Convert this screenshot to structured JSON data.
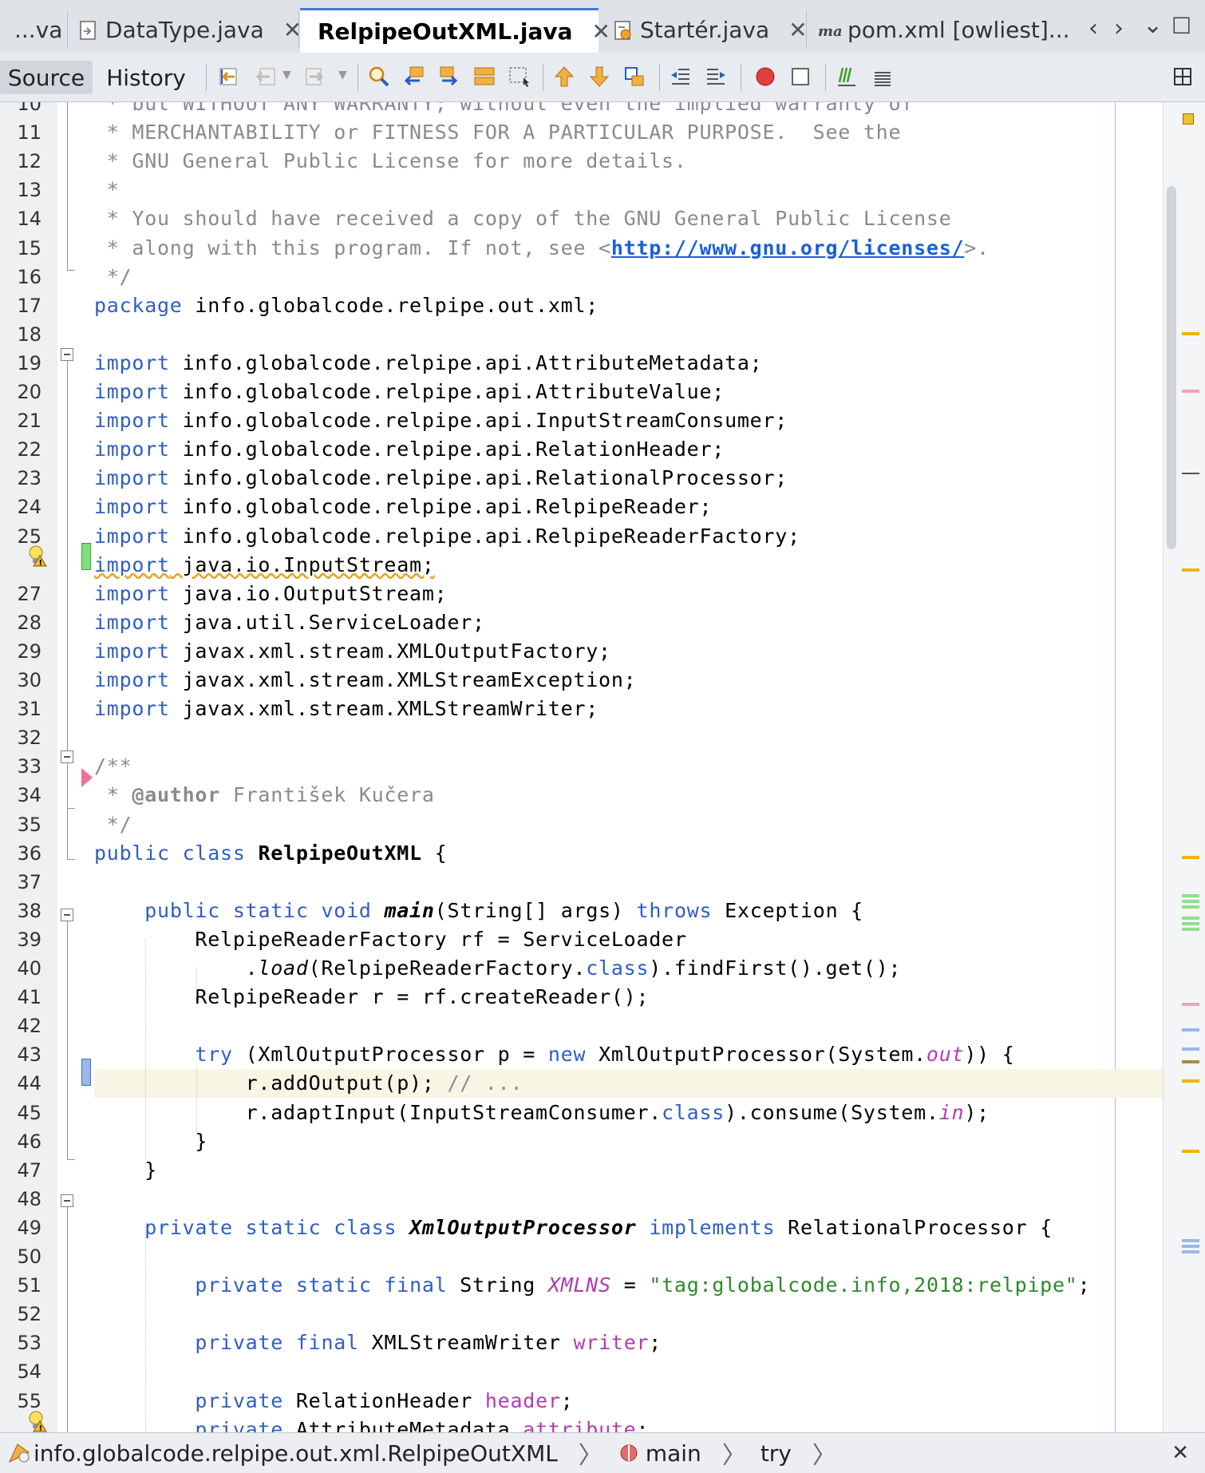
{
  "tabs": [
    {
      "label": "...va",
      "closable": false
    },
    {
      "label": "DataType.java",
      "closable": true
    },
    {
      "label": "RelpipeOutXML.java",
      "closable": true,
      "active": true
    },
    {
      "label": "Startér.java",
      "closable": true
    },
    {
      "label": "pom.xml [owliest]...",
      "closable": false
    }
  ],
  "tab_nav": {
    "prev": "‹",
    "next": "›",
    "menu": "⌄",
    "maximize": "☐"
  },
  "toolbar": {
    "source_label": "Source",
    "history_label": "History"
  },
  "breadcrumb": {
    "items": [
      "info.globalcode.relpipe.out.xml.RelpipeOutXML",
      "main",
      "try"
    ],
    "close": "✕"
  },
  "colors": {
    "keyword": "#2f5ec4",
    "comment": "#8a8a8a",
    "string": "#2c8a2c",
    "field": "#b03cb0",
    "active_tab_accent": "#3d7bd8"
  },
  "lines": [
    {
      "n": "10",
      "tokens": [
        [
          "cm",
          " * but WITHOUT ANY WARRANTY; without even the implied warranty of"
        ]
      ]
    },
    {
      "n": "11",
      "tokens": [
        [
          "cm",
          " * MERCHANTABILITY or FITNESS FOR A PARTICULAR PURPOSE.  See the"
        ]
      ]
    },
    {
      "n": "12",
      "tokens": [
        [
          "cm",
          " * GNU General Public License for more details."
        ]
      ]
    },
    {
      "n": "13",
      "tokens": [
        [
          "cm",
          " *"
        ]
      ]
    },
    {
      "n": "14",
      "tokens": [
        [
          "cm",
          " * You should have received a copy of the GNU General Public License"
        ]
      ]
    },
    {
      "n": "15",
      "tokens": [
        [
          "cm",
          " * along with this program. If not, see <"
        ],
        [
          "link",
          "http://www.gnu.org/licenses/"
        ],
        [
          "cm",
          ">."
        ]
      ]
    },
    {
      "n": "16",
      "tokens": [
        [
          "cm",
          " */"
        ]
      ]
    },
    {
      "n": "17",
      "tokens": [
        [
          "kw",
          "package"
        ],
        [
          "",
          " info.globalcode.relpipe.out.xml;"
        ]
      ]
    },
    {
      "n": "18",
      "tokens": []
    },
    {
      "n": "19",
      "tokens": [
        [
          "kw",
          "import"
        ],
        [
          "",
          " info.globalcode.relpipe.api.AttributeMetadata;"
        ]
      ]
    },
    {
      "n": "20",
      "tokens": [
        [
          "kw",
          "import"
        ],
        [
          "",
          " info.globalcode.relpipe.api.AttributeValue;"
        ]
      ]
    },
    {
      "n": "21",
      "tokens": [
        [
          "kw",
          "import"
        ],
        [
          "",
          " info.globalcode.relpipe.api.InputStreamConsumer;"
        ]
      ]
    },
    {
      "n": "22",
      "tokens": [
        [
          "kw",
          "import"
        ],
        [
          "",
          " info.globalcode.relpipe.api.RelationHeader;"
        ]
      ]
    },
    {
      "n": "23",
      "tokens": [
        [
          "kw",
          "import"
        ],
        [
          "",
          " info.globalcode.relpipe.api.RelationalProcessor;"
        ]
      ]
    },
    {
      "n": "24",
      "tokens": [
        [
          "kw",
          "import"
        ],
        [
          "",
          " info.globalcode.relpipe.api.RelpipeReader;"
        ]
      ]
    },
    {
      "n": "25",
      "tokens": [
        [
          "kw",
          "import"
        ],
        [
          "",
          " info.globalcode.relpipe.api.RelpipeReaderFactory;"
        ]
      ]
    },
    {
      "n": "",
      "tokens": [
        [
          "warnkw",
          "import"
        ],
        [
          "warn",
          " java.io.InputStream;"
        ]
      ]
    },
    {
      "n": "27",
      "tokens": [
        [
          "kw",
          "import"
        ],
        [
          "",
          " java.io.OutputStream;"
        ]
      ]
    },
    {
      "n": "28",
      "tokens": [
        [
          "kw",
          "import"
        ],
        [
          "",
          " java.util.ServiceLoader;"
        ]
      ]
    },
    {
      "n": "29",
      "tokens": [
        [
          "kw",
          "import"
        ],
        [
          "",
          " javax.xml.stream.XMLOutputFactory;"
        ]
      ]
    },
    {
      "n": "30",
      "tokens": [
        [
          "kw",
          "import"
        ],
        [
          "",
          " javax.xml.stream.XMLStreamException;"
        ]
      ]
    },
    {
      "n": "31",
      "tokens": [
        [
          "kw",
          "import"
        ],
        [
          "",
          " javax.xml.stream.XMLStreamWriter;"
        ]
      ]
    },
    {
      "n": "32",
      "tokens": []
    },
    {
      "n": "33",
      "tokens": [
        [
          "cm",
          "/**"
        ]
      ]
    },
    {
      "n": "34",
      "tokens": [
        [
          "cm",
          " * "
        ],
        [
          "tag",
          "@author"
        ],
        [
          "cm",
          " František Kučera"
        ]
      ]
    },
    {
      "n": "35",
      "tokens": [
        [
          "cm",
          " */"
        ]
      ]
    },
    {
      "n": "36",
      "tokens": [
        [
          "kw",
          "public"
        ],
        [
          "",
          " "
        ],
        [
          "kw",
          "class"
        ],
        [
          "",
          " "
        ],
        [
          "bold",
          "RelpipeOutXML"
        ],
        [
          "",
          " {"
        ]
      ]
    },
    {
      "n": "37",
      "tokens": []
    },
    {
      "n": "38",
      "tokens": [
        [
          "",
          "    "
        ],
        [
          "kw",
          "public"
        ],
        [
          "",
          " "
        ],
        [
          "kw",
          "static"
        ],
        [
          "",
          " "
        ],
        [
          "kw",
          "void"
        ],
        [
          "",
          " "
        ],
        [
          "bi",
          "main"
        ],
        [
          "",
          "(String[] args) "
        ],
        [
          "kw",
          "throws"
        ],
        [
          "",
          " Exception {"
        ]
      ]
    },
    {
      "n": "39",
      "tokens": [
        [
          "",
          "        RelpipeReaderFactory rf = ServiceLoader"
        ]
      ]
    },
    {
      "n": "40",
      "tokens": [
        [
          "",
          "            ."
        ],
        [
          "it",
          "load"
        ],
        [
          "",
          "(RelpipeReaderFactory."
        ],
        [
          "kw",
          "class"
        ],
        [
          "",
          ").findFirst().get();"
        ]
      ]
    },
    {
      "n": "41",
      "tokens": [
        [
          "",
          "        RelpipeReader r = rf.createReader();"
        ]
      ]
    },
    {
      "n": "42",
      "tokens": []
    },
    {
      "n": "43",
      "tokens": [
        [
          "",
          "        "
        ],
        [
          "kw",
          "try"
        ],
        [
          "",
          " (XmlOutputProcessor p = "
        ],
        [
          "kw",
          "new"
        ],
        [
          "",
          " XmlOutputProcessor(System."
        ],
        [
          "sfld",
          "out"
        ],
        [
          "",
          ")) {"
        ]
      ]
    },
    {
      "n": "44",
      "hl": true,
      "tokens": [
        [
          "",
          "            r.addOutput(p); "
        ],
        [
          "cm",
          "// ..."
        ]
      ]
    },
    {
      "n": "45",
      "tokens": [
        [
          "",
          "            r.adaptInput(InputStreamConsumer."
        ],
        [
          "kw",
          "class"
        ],
        [
          "",
          ").consume(System."
        ],
        [
          "sfld",
          "in"
        ],
        [
          "",
          ");"
        ]
      ]
    },
    {
      "n": "46",
      "tokens": [
        [
          "",
          "        }"
        ]
      ]
    },
    {
      "n": "47",
      "tokens": [
        [
          "",
          "    }"
        ]
      ]
    },
    {
      "n": "48",
      "tokens": []
    },
    {
      "n": "49",
      "tokens": [
        [
          "",
          "    "
        ],
        [
          "kw",
          "private"
        ],
        [
          "",
          " "
        ],
        [
          "kw",
          "static"
        ],
        [
          "",
          " "
        ],
        [
          "kw",
          "class"
        ],
        [
          "",
          " "
        ],
        [
          "bi",
          "XmlOutputProcessor"
        ],
        [
          "",
          " "
        ],
        [
          "kw",
          "implements"
        ],
        [
          "",
          " RelationalProcessor {"
        ]
      ]
    },
    {
      "n": "50",
      "tokens": []
    },
    {
      "n": "51",
      "tokens": [
        [
          "",
          "        "
        ],
        [
          "kw",
          "private"
        ],
        [
          "",
          " "
        ],
        [
          "kw",
          "static"
        ],
        [
          "",
          " "
        ],
        [
          "kw",
          "final"
        ],
        [
          "",
          " String "
        ],
        [
          "sfld",
          "XMLNS"
        ],
        [
          "",
          " = "
        ],
        [
          "str",
          "\"tag:globalcode.info,2018:relpipe\""
        ],
        [
          "",
          ";"
        ]
      ]
    },
    {
      "n": "52",
      "tokens": []
    },
    {
      "n": "53",
      "tokens": [
        [
          "",
          "        "
        ],
        [
          "kw",
          "private"
        ],
        [
          "",
          " "
        ],
        [
          "kw",
          "final"
        ],
        [
          "",
          " XMLStreamWriter "
        ],
        [
          "fld",
          "writer"
        ],
        [
          "",
          ";"
        ]
      ]
    },
    {
      "n": "54",
      "tokens": []
    },
    {
      "n": "55",
      "tokens": [
        [
          "",
          "        "
        ],
        [
          "kw",
          "private"
        ],
        [
          "",
          " RelationHeader "
        ],
        [
          "fld",
          "header"
        ],
        [
          "",
          ";"
        ]
      ]
    },
    {
      "n": "",
      "tokens": [
        [
          "",
          "        "
        ],
        [
          "kw",
          "private"
        ],
        [
          "",
          " AttributeMetadata "
        ],
        [
          "fldwarn",
          "attribute"
        ],
        [
          "",
          ";"
        ]
      ]
    }
  ]
}
